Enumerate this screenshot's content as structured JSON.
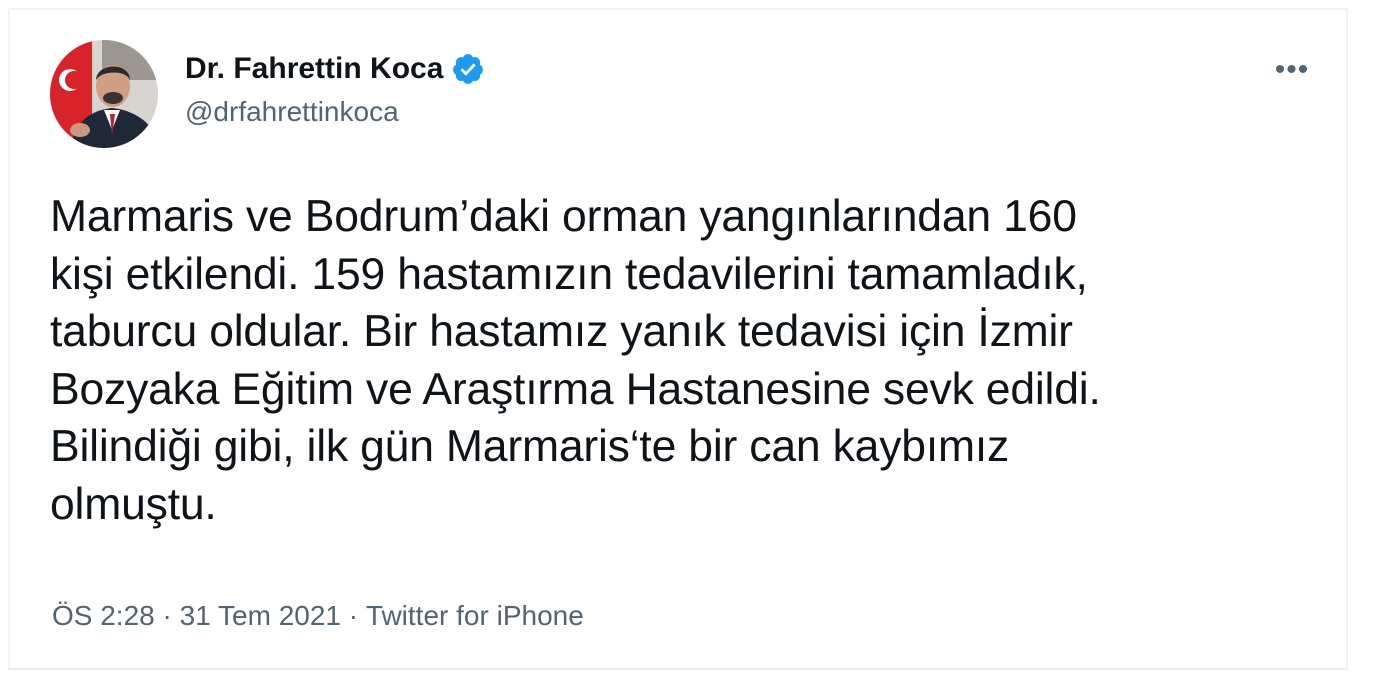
{
  "tweet": {
    "author": {
      "name": "Dr. Fahrettin Koca",
      "handle": "@drfahrettinkoca",
      "verified_icon": "verified-badge-icon",
      "verified_color": "#1d9bf0"
    },
    "more_label": "•••",
    "text": "Marmaris ve Bodrum’daki orman yangınlarından 160\nkişi etkilendi. 159 hastamızın tedavilerini tamamladık,\ntaburcu oldular. Bir hastamız yanık tedavisi için İzmir\nBozyaka Eğitim ve Araştırma Hastanesine sevk edildi.\nBilindiği gibi, ilk gün Marmaris‘te bir can kaybımız\nolmuştu.",
    "meta": {
      "time": "ÖS 2:28",
      "separator": " · ",
      "date": "31 Tem 2021",
      "source": "Twitter for iPhone"
    }
  }
}
